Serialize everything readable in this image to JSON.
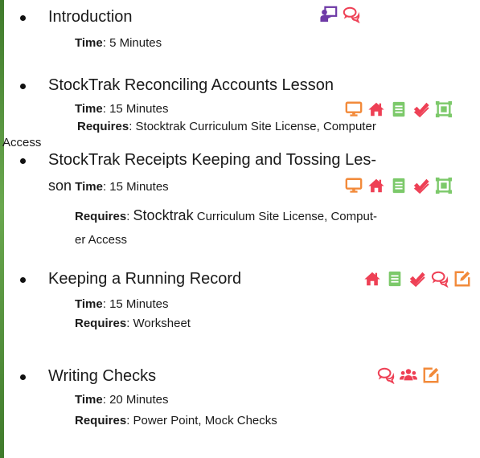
{
  "labels": {
    "time": "Time",
    "requires": "Requires"
  },
  "items": [
    {
      "title": "Introduction",
      "time": ": 5 Minutes",
      "icons": [
        "presentation-teacher-icon",
        "chat-bubbles-icon"
      ]
    },
    {
      "title": "StockTrak Reconciling Accounts Lesson",
      "time": ": 15 Minutes",
      "requires_a": ": Stocktrak Curriculum Site License, Computer",
      "requires_b": "Access",
      "icons": [
        "computer-monitor-icon",
        "home-icon",
        "book-icon",
        "check-mark-icon",
        "crop-frame-icon"
      ]
    },
    {
      "title_a": "StockTrak Receipts Keeping and Tossing  Les-",
      "title_b": "son",
      "time": ": 15 Minutes",
      "requires_prefix": ": ",
      "requires_big": "Stocktrak",
      "requires_rest": " Curriculum Site License, Comput-",
      "requires_b": "er Access",
      "icons": [
        "computer-monitor-icon",
        "home-icon",
        "book-icon",
        "check-mark-icon",
        "crop-frame-icon"
      ]
    },
    {
      "title": "Keeping a Running Record",
      "time": ": 15 Minutes",
      "requires": ": Worksheet",
      "icons": [
        "home-icon",
        "book-icon",
        "check-mark-icon",
        "chat-bubbles-icon",
        "edit-external-icon"
      ]
    },
    {
      "title": "Writing Checks",
      "time": ": 20 Minutes",
      "requires": ": Power Point, Mock Checks",
      "icons": [
        "chat-bubbles-icon",
        "group-icon",
        "edit-external-icon"
      ]
    }
  ],
  "colors": {
    "orange": "#f28a3a",
    "green": "#7cc96a",
    "red": "#ee4055",
    "purple": "#6e3aa6"
  }
}
